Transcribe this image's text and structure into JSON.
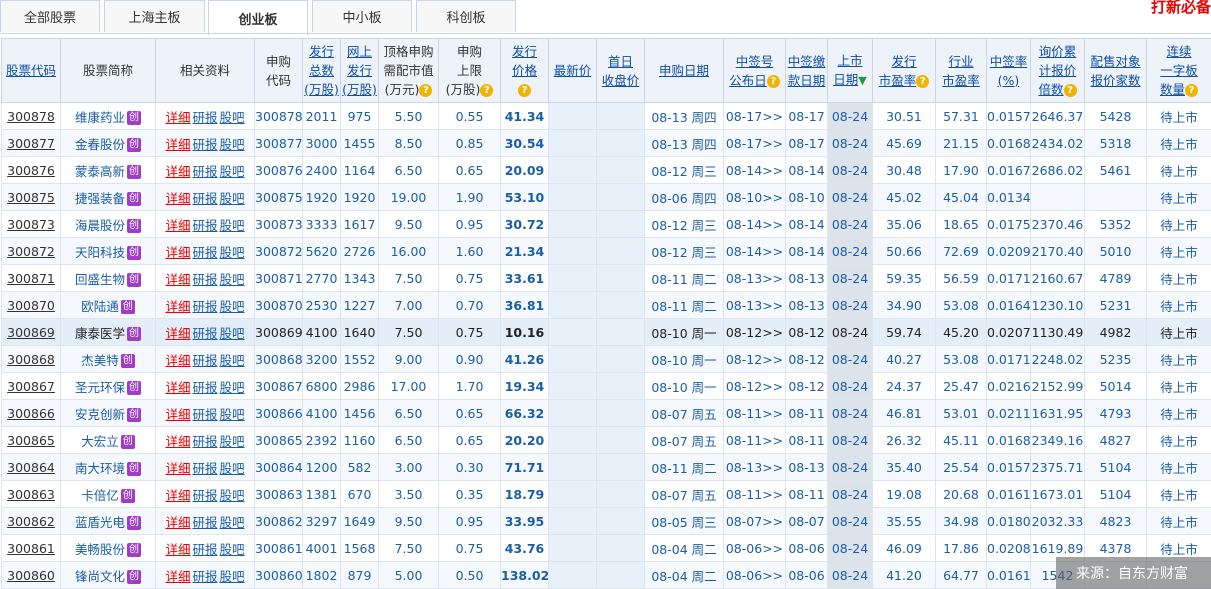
{
  "tabs": [
    "全部股票",
    "上海主板",
    "创业板",
    "中小板",
    "科创板"
  ],
  "active_tab": 2,
  "promo": "打新必备",
  "headers": {
    "code": "股票代码",
    "name": "股票简称",
    "info": "相关资料",
    "sg_code_1": "申购",
    "sg_code_2": "代码",
    "total_1": "发行",
    "total_2": "总数",
    "total_3": "(万股)",
    "online_1": "网上",
    "online_2": "发行",
    "online_3": "(万股)",
    "mv_1": "顶格申购",
    "mv_2": "需配市值",
    "mv_3": "(万元)",
    "limit_1": "申购",
    "limit_2": "上限",
    "limit_3": "(万股)",
    "price_1": "发行",
    "price_2": "价格",
    "latest": "最新价",
    "first_1": "首日",
    "first_2": "收盘价",
    "date": "申购日期",
    "pub_1": "中签号",
    "pub_2": "公布日",
    "pay_1": "中签缴",
    "pay_2": "款日期",
    "list_1": "上市",
    "list_2": "日期",
    "pe_1": "发行",
    "pe_2": "市盈率",
    "ind_1": "行业",
    "ind_2": "市盈率",
    "rate_1": "中签率",
    "rate_2": "(%)",
    "inq_1": "询价累",
    "inq_2": "计报价",
    "inq_3": "倍数",
    "alloc_1": "配售对象",
    "alloc_2": "报价家数",
    "cont_1": "连续",
    "cont_2": "一字板",
    "cont_3": "数量"
  },
  "link_labels": [
    "详细",
    "研报",
    "股吧"
  ],
  "board_tag": "创",
  "rows": [
    {
      "code": "300878",
      "name": "维康药业",
      "total": "2011",
      "online": "975",
      "mv": "5.50",
      "limit": "0.55",
      "price": "41.34",
      "date": "08-13 周四",
      "pub": "08-17",
      "pay": "08-17",
      "list": "08-24",
      "pe": "30.51",
      "ind": "57.31",
      "rate": "0.0157",
      "inq": "2646.37",
      "alloc": "5428",
      "status": "待上市"
    },
    {
      "code": "300877",
      "name": "金春股份",
      "total": "3000",
      "online": "1455",
      "mv": "8.50",
      "limit": "0.85",
      "price": "30.54",
      "date": "08-13 周四",
      "pub": "08-17",
      "pay": "08-17",
      "list": "08-24",
      "pe": "45.69",
      "ind": "21.15",
      "rate": "0.0168",
      "inq": "2434.02",
      "alloc": "5318",
      "status": "待上市"
    },
    {
      "code": "300876",
      "name": "蒙泰高新",
      "total": "2400",
      "online": "1164",
      "mv": "6.50",
      "limit": "0.65",
      "price": "20.09",
      "date": "08-12 周三",
      "pub": "08-14",
      "pay": "08-14",
      "list": "08-24",
      "pe": "30.48",
      "ind": "17.90",
      "rate": "0.0167",
      "inq": "2686.02",
      "alloc": "5461",
      "status": "待上市"
    },
    {
      "code": "300875",
      "name": "捷强装备",
      "total": "1920",
      "online": "1920",
      "mv": "19.00",
      "limit": "1.90",
      "price": "53.10",
      "date": "08-06 周四",
      "pub": "08-10",
      "pay": "08-10",
      "list": "08-24",
      "pe": "45.02",
      "ind": "45.04",
      "rate": "0.0134",
      "inq": "",
      "alloc": "",
      "status": "待上市"
    },
    {
      "code": "300873",
      "name": "海晨股份",
      "total": "3333",
      "online": "1617",
      "mv": "9.50",
      "limit": "0.95",
      "price": "30.72",
      "date": "08-12 周三",
      "pub": "08-14",
      "pay": "08-14",
      "list": "08-24",
      "pe": "35.06",
      "ind": "18.65",
      "rate": "0.0175",
      "inq": "2370.46",
      "alloc": "5352",
      "status": "待上市"
    },
    {
      "code": "300872",
      "name": "天阳科技",
      "total": "5620",
      "online": "2726",
      "mv": "16.00",
      "limit": "1.60",
      "price": "21.34",
      "date": "08-12 周三",
      "pub": "08-14",
      "pay": "08-14",
      "list": "08-24",
      "pe": "50.66",
      "ind": "72.69",
      "rate": "0.0209",
      "inq": "2170.40",
      "alloc": "5010",
      "status": "待上市"
    },
    {
      "code": "300871",
      "name": "回盛生物",
      "total": "2770",
      "online": "1343",
      "mv": "7.50",
      "limit": "0.75",
      "price": "33.61",
      "date": "08-11 周二",
      "pub": "08-13",
      "pay": "08-13",
      "list": "08-24",
      "pe": "59.35",
      "ind": "56.59",
      "rate": "0.0171",
      "inq": "2160.67",
      "alloc": "4789",
      "status": "待上市"
    },
    {
      "code": "300870",
      "name": "欧陆通",
      "total": "2530",
      "online": "1227",
      "mv": "7.00",
      "limit": "0.70",
      "price": "36.81",
      "date": "08-11 周二",
      "pub": "08-13",
      "pay": "08-13",
      "list": "08-24",
      "pe": "34.90",
      "ind": "53.08",
      "rate": "0.0164",
      "inq": "1230.10",
      "alloc": "5231",
      "status": "待上市"
    },
    {
      "code": "300869",
      "name": "康泰医学",
      "total": "4100",
      "online": "1640",
      "mv": "7.50",
      "limit": "0.75",
      "price": "10.16",
      "date": "08-10 周一",
      "pub": "08-12",
      "pay": "08-12",
      "list": "08-24",
      "pe": "59.74",
      "ind": "45.20",
      "rate": "0.0207",
      "inq": "1130.49",
      "alloc": "4982",
      "status": "待上市"
    },
    {
      "code": "300868",
      "name": "杰美特",
      "total": "3200",
      "online": "1552",
      "mv": "9.00",
      "limit": "0.90",
      "price": "41.26",
      "date": "08-10 周一",
      "pub": "08-12",
      "pay": "08-12",
      "list": "08-24",
      "pe": "40.27",
      "ind": "53.08",
      "rate": "0.0171",
      "inq": "2248.02",
      "alloc": "5235",
      "status": "待上市"
    },
    {
      "code": "300867",
      "name": "圣元环保",
      "total": "6800",
      "online": "2986",
      "mv": "17.00",
      "limit": "1.70",
      "price": "19.34",
      "date": "08-10 周一",
      "pub": "08-12",
      "pay": "08-12",
      "list": "08-24",
      "pe": "24.37",
      "ind": "25.47",
      "rate": "0.0216",
      "inq": "2152.99",
      "alloc": "5014",
      "status": "待上市"
    },
    {
      "code": "300866",
      "name": "安克创新",
      "total": "4100",
      "online": "1456",
      "mv": "6.50",
      "limit": "0.65",
      "price": "66.32",
      "date": "08-07 周五",
      "pub": "08-11",
      "pay": "08-11",
      "list": "08-24",
      "pe": "46.81",
      "ind": "53.01",
      "rate": "0.0211",
      "inq": "1631.95",
      "alloc": "4793",
      "status": "待上市"
    },
    {
      "code": "300865",
      "name": "大宏立",
      "total": "2392",
      "online": "1160",
      "mv": "6.50",
      "limit": "0.65",
      "price": "20.20",
      "date": "08-07 周五",
      "pub": "08-11",
      "pay": "08-11",
      "list": "08-24",
      "pe": "26.32",
      "ind": "45.11",
      "rate": "0.0168",
      "inq": "2349.16",
      "alloc": "4827",
      "status": "待上市"
    },
    {
      "code": "300864",
      "name": "南大环境",
      "total": "1200",
      "online": "582",
      "mv": "3.00",
      "limit": "0.30",
      "price": "71.71",
      "date": "08-11 周二",
      "pub": "08-13",
      "pay": "08-13",
      "list": "08-24",
      "pe": "35.40",
      "ind": "25.54",
      "rate": "0.0157",
      "inq": "2375.71",
      "alloc": "5104",
      "status": "待上市"
    },
    {
      "code": "300863",
      "name": "卡倍亿",
      "total": "1381",
      "online": "670",
      "mv": "3.50",
      "limit": "0.35",
      "price": "18.79",
      "date": "08-07 周五",
      "pub": "08-11",
      "pay": "08-11",
      "list": "08-24",
      "pe": "19.08",
      "ind": "20.68",
      "rate": "0.0161",
      "inq": "1673.01",
      "alloc": "5104",
      "status": "待上市"
    },
    {
      "code": "300862",
      "name": "蓝盾光电",
      "total": "3297",
      "online": "1649",
      "mv": "9.50",
      "limit": "0.95",
      "price": "33.95",
      "date": "08-05 周三",
      "pub": "08-07",
      "pay": "08-07",
      "list": "08-24",
      "pe": "35.55",
      "ind": "34.98",
      "rate": "0.0180",
      "inq": "2032.33",
      "alloc": "4823",
      "status": "待上市"
    },
    {
      "code": "300861",
      "name": "美畅股份",
      "total": "4001",
      "online": "1568",
      "mv": "7.50",
      "limit": "0.75",
      "price": "43.76",
      "date": "08-04 周二",
      "pub": "08-06",
      "pay": "08-06",
      "list": "08-24",
      "pe": "46.09",
      "ind": "17.86",
      "rate": "0.0208",
      "inq": "1619.89",
      "alloc": "4378",
      "status": "待上市"
    },
    {
      "code": "300860",
      "name": "锋尚文化",
      "total": "1802",
      "online": "879",
      "mv": "5.00",
      "limit": "0.50",
      "price": "138.02",
      "date": "08-04 周二",
      "pub": "08-06",
      "pay": "08-06",
      "list": "08-24",
      "pe": "41.20",
      "ind": "64.77",
      "rate": "0.0161",
      "inq": "1542",
      "alloc": "",
      "status": ""
    }
  ],
  "source": "来源：自东方财富"
}
